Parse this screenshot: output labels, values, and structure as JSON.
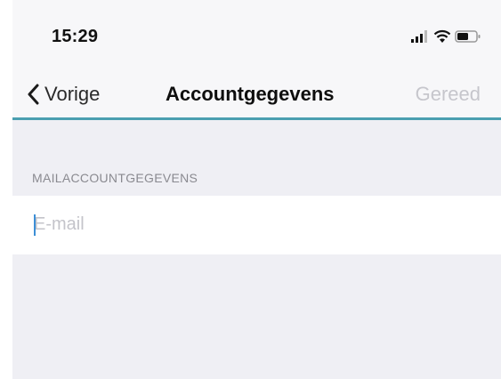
{
  "status_bar": {
    "time": "15:29",
    "icons": [
      "signal-icon",
      "wifi-icon",
      "battery-icon"
    ]
  },
  "nav": {
    "back_label": "Vorige",
    "title": "Accountgegevens",
    "done_label": "Gereed"
  },
  "section": {
    "header": "MAILACCOUNTGEGEVENS",
    "email_field": {
      "value": "",
      "placeholder": "E-mail"
    }
  },
  "colors": {
    "accent_line": "#4a9fb0",
    "cursor": "#3c8fd6",
    "background": "#efeff4"
  }
}
